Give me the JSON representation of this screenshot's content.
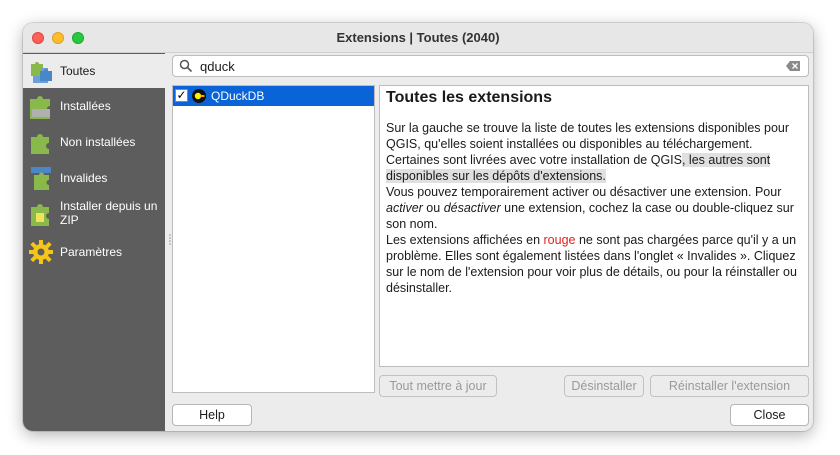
{
  "window": {
    "title": "Extensions | Toutes (2040)"
  },
  "sidebar": {
    "items": [
      {
        "label": "Toutes",
        "icon": "puzzle-all-icon"
      },
      {
        "label": "Installées",
        "icon": "puzzle-installed-icon"
      },
      {
        "label": "Non installées",
        "icon": "puzzle-not-installed-icon"
      },
      {
        "label": "Invalides",
        "icon": "puzzle-invalid-icon"
      },
      {
        "label": "Installer depuis un ZIP",
        "icon": "zip-install-icon"
      },
      {
        "label": "Paramètres",
        "icon": "settings-gear-icon"
      }
    ]
  },
  "search": {
    "value": "qduck"
  },
  "plugins": [
    {
      "name": "QDuckDB",
      "checked": true
    }
  ],
  "details": {
    "heading": "Toutes les extensions",
    "p1a": "Sur la gauche se trouve la liste de toutes les extensions disponibles pour QGIS, qu'elles soient installées ou disponibles au téléchargement. Certaines sont livrées avec votre installation de QGIS",
    "p1b": ", les autres sont disponibles sur les dépôts d'extensions.",
    "p2a": "Vous pouvez temporairement activer ou désactiver une extension. Pour ",
    "p2b": "activer",
    "p2c": " ou ",
    "p2d": "désactiver",
    "p2e": " une extension, cochez la case ou double-cliquez sur son nom.",
    "p3a": "Les extensions affichées en ",
    "p3b": "rouge",
    "p3c": " ne sont pas chargées parce qu'il y a un problème. Elles sont également listées dans l'onglet « Invalides ». Cliquez sur le nom de l'extension pour voir plus de détails, ou pour la réinstaller ou désinstaller."
  },
  "buttons": {
    "upgrade_all": "Tout mettre à jour",
    "uninstall": "Désinstaller",
    "reinstall": "Réinstaller l'extension",
    "help": "Help",
    "close": "Close"
  },
  "colors": {
    "sidebar_bg": "#5d5d5d",
    "selection": "#0a64d8",
    "error_red": "#e0221e"
  }
}
